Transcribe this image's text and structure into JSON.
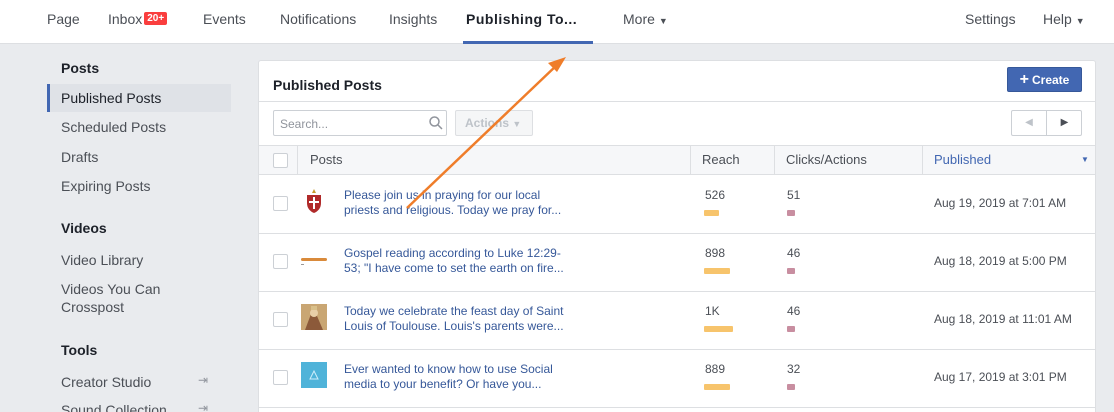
{
  "nav": {
    "page": "Page",
    "inbox": "Inbox",
    "inbox_badge": "20+",
    "events": "Events",
    "notifications": "Notifications",
    "insights": "Insights",
    "publishing_tools": "Publishing To...",
    "more": "More",
    "settings": "Settings",
    "help": "Help"
  },
  "sidebar": {
    "posts_heading": "Posts",
    "posts_items": [
      "Published Posts",
      "Scheduled Posts",
      "Drafts",
      "Expiring Posts"
    ],
    "videos_heading": "Videos",
    "videos_items": [
      "Video Library",
      "Videos You Can",
      "Crosspost"
    ],
    "tools_heading": "Tools",
    "tools_items": [
      "Creator Studio",
      "Sound Collection"
    ]
  },
  "panel": {
    "title": "Published Posts",
    "create_label": "Create",
    "search_placeholder": "Search...",
    "actions_label": "Actions"
  },
  "table": {
    "headers": [
      "Posts",
      "Reach",
      "Clicks/Actions",
      "Published"
    ],
    "rows": [
      {
        "text_line1": "Please join us in praying for our local",
        "text_line2": "priests and religious. Today we pray for...",
        "reach": "526",
        "reach_fraction": 0.5,
        "clicks": "51",
        "published": "Aug 19, 2019 at 7:01 AM",
        "thumb": "crest"
      },
      {
        "text_line1": "Gospel reading according to Luke 12:29-",
        "text_line2": "53; \"I have come to set the earth on fire...",
        "reach": "898",
        "reach_fraction": 0.85,
        "clicks": "46",
        "published": "Aug 18, 2019 at 5:00 PM",
        "thumb": "banner"
      },
      {
        "text_line1": "Today we celebrate the feast day of Saint",
        "text_line2": "Louis of Toulouse. Louis's parents were...",
        "reach": "1K",
        "reach_fraction": 0.95,
        "clicks": "46",
        "published": "Aug 18, 2019 at 11:01 AM",
        "thumb": "painting"
      },
      {
        "text_line1": "Ever wanted to know how to use Social",
        "text_line2": "media to your benefit? Or have you...",
        "reach": "889",
        "reach_fraction": 0.85,
        "clicks": "32",
        "published": "Aug 17, 2019 at 3:01 PM",
        "thumb": "social"
      }
    ]
  },
  "colors": {
    "accent": "#4267b2",
    "badge": "#fa3e3e",
    "reach_bar": "#f7c46c",
    "clicks_bar": "#c88ea0",
    "annotation_arrow": "#ef7d2a"
  }
}
